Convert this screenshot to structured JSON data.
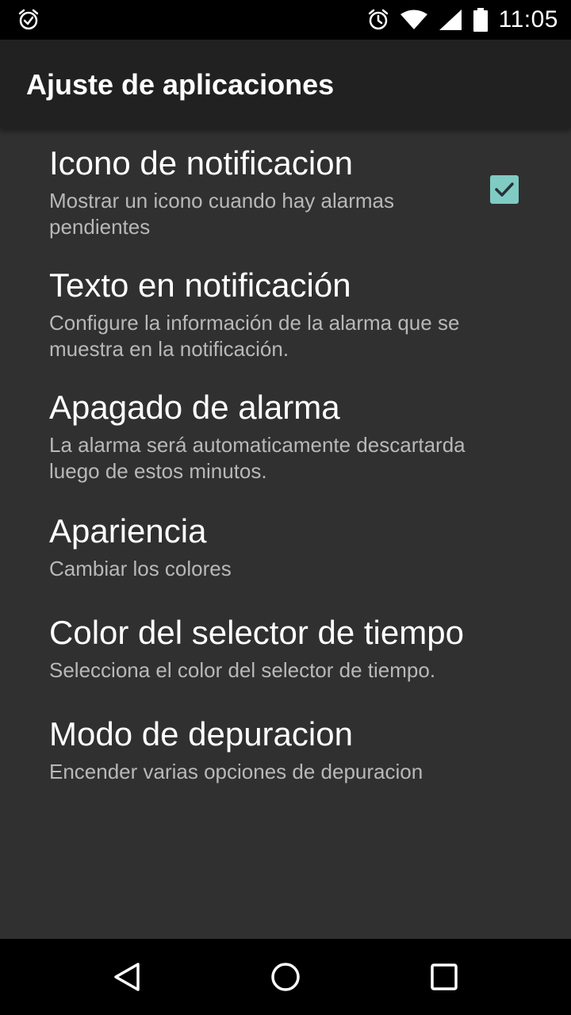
{
  "status_bar": {
    "left_icon": "alarm-check-icon",
    "right_icons": [
      "alarm-clock-icon",
      "wifi-icon",
      "signal-icon",
      "battery-icon"
    ],
    "time": "11:05"
  },
  "toolbar": {
    "title": "Ajuste de aplicaciones"
  },
  "preferences": [
    {
      "title": "Icono de notificacion",
      "summary": "Mostrar un icono cuando hay alarmas pendientes",
      "checkbox": true
    },
    {
      "title": "Texto en notificación",
      "summary": "Configure la información de la alarma que se muestra en la notificación."
    },
    {
      "title": "Apagado de alarma",
      "summary": "La alarma será automaticamente descartarda luego de estos minutos."
    },
    {
      "title": "Apariencia",
      "summary": "Cambiar los colores"
    },
    {
      "title": "Color del selector de tiempo",
      "summary": "Selecciona el color del selector de tiempo."
    },
    {
      "title": "Modo de depuracion",
      "summary": "Encender varias opciones de depuracion"
    }
  ],
  "nav_bar": {
    "buttons": [
      "back-icon",
      "home-icon",
      "recents-icon"
    ]
  },
  "colors": {
    "background": "#303030",
    "toolbar": "#212121",
    "accent": "#80cbc4",
    "summary_text": "#b8b8b8"
  }
}
